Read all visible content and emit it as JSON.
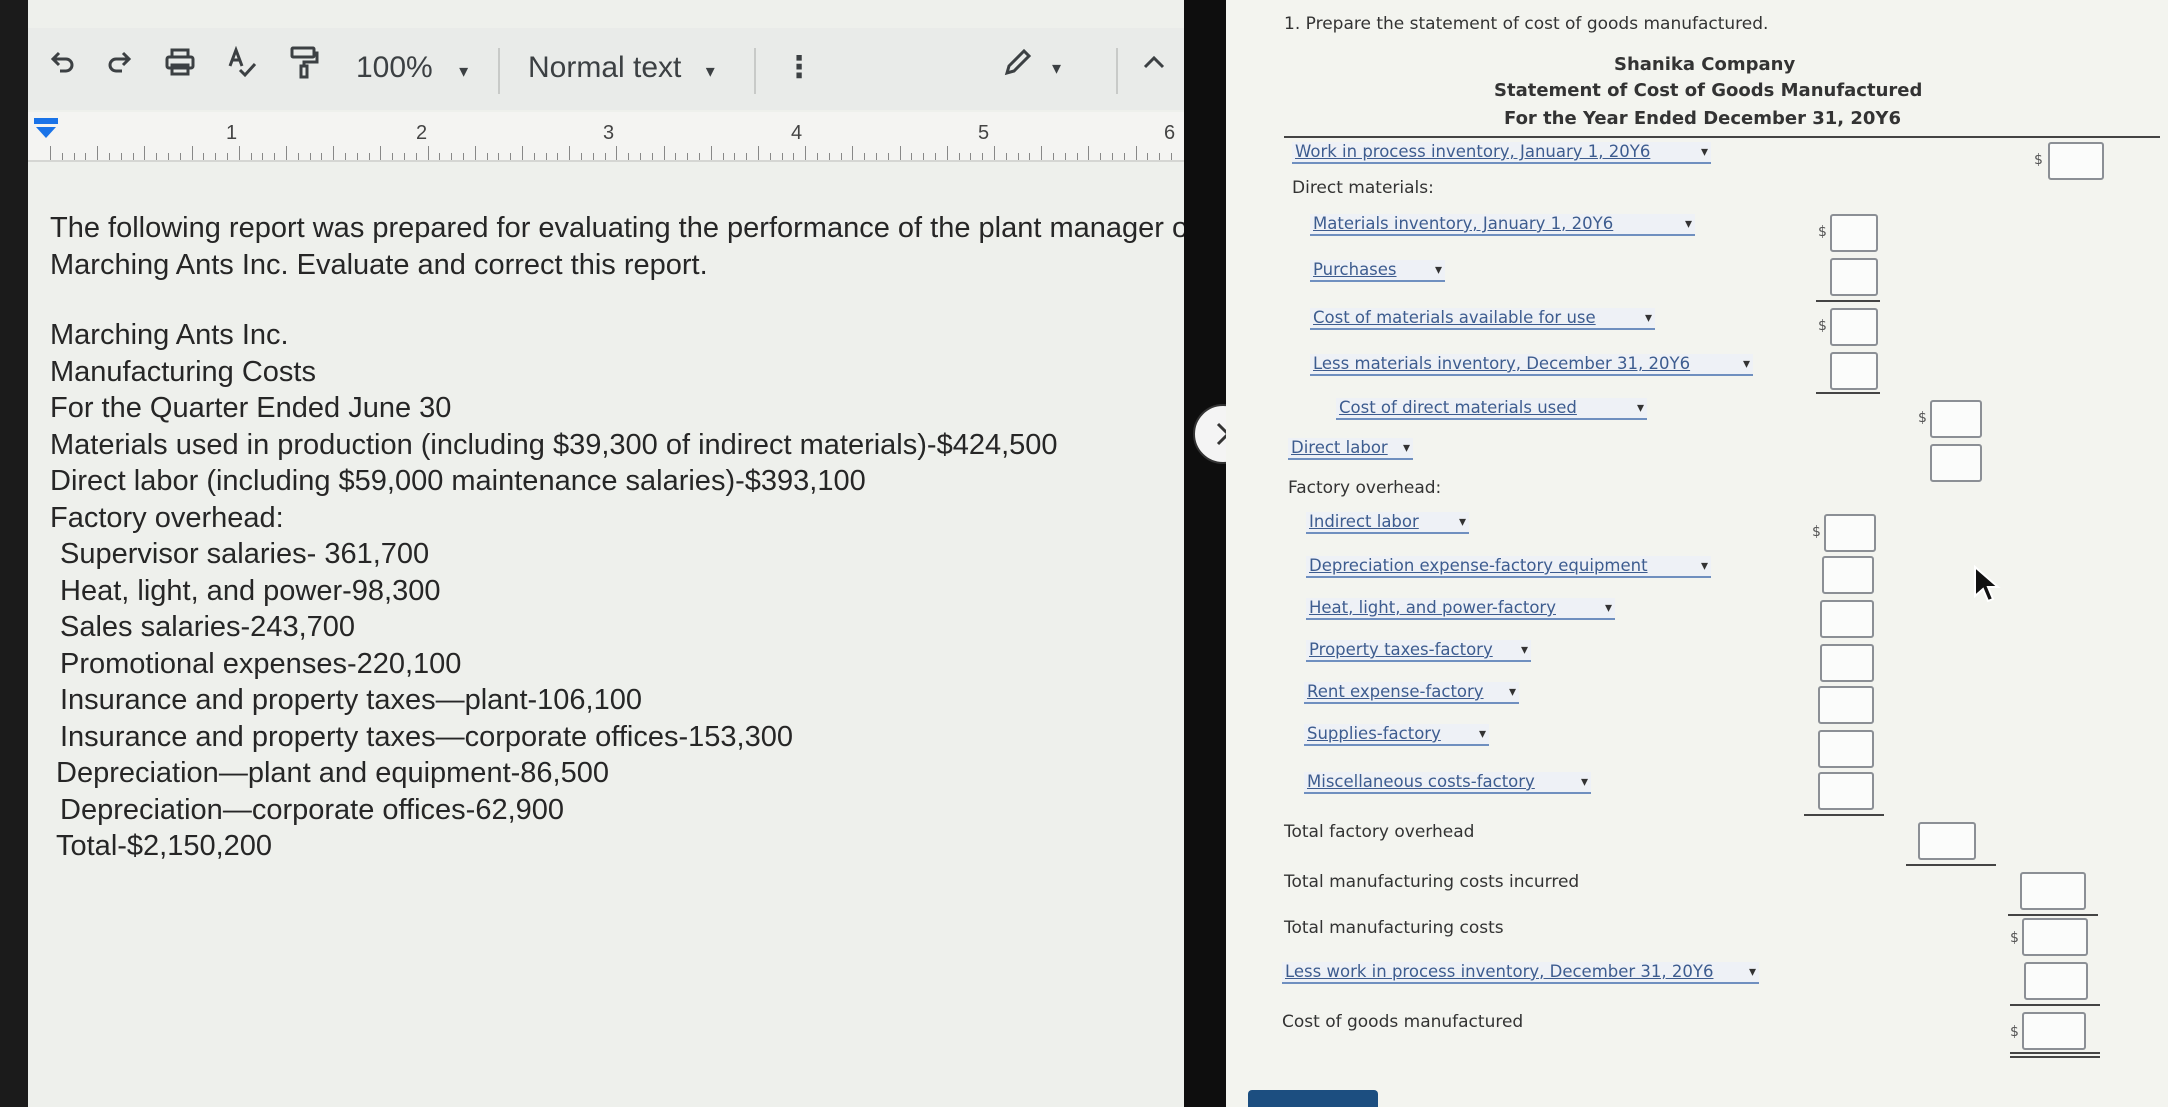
{
  "toolbar": {
    "zoom": "100%",
    "style": "Normal text",
    "more": "⋮"
  },
  "ruler": {
    "marks": [
      "1",
      "2",
      "3",
      "4",
      "5",
      "6"
    ]
  },
  "document": {
    "intro_line1": "The following report was prepared for evaluating the performance of the plant manager of",
    "intro_line2": "Marching Ants Inc. Evaluate and correct this report.",
    "company": "Marching Ants Inc.",
    "report_title": "Manufacturing Costs",
    "period": "For the Quarter Ended June 30",
    "materials": "Materials used in production (including $39,300 of indirect materials)-$424,500",
    "labor": "Direct labor (including $59,000 maintenance salaries)-$393,100",
    "overhead_heading": "Factory overhead:",
    "overhead_items": [
      "Supervisor salaries- 361,700",
      "Heat, light, and power-98,300",
      "Sales salaries-243,700",
      "Promotional expenses-220,100",
      "Insurance and property taxes—plant-106,100",
      "Insurance and property taxes—corporate offices-153,300",
      "Depreciation—plant and equipment-86,500",
      "Depreciation—corporate offices-62,900"
    ],
    "total": "Total-$2,150,200"
  },
  "worksheet": {
    "instruction": "1. Prepare the statement of cost of goods manufactured.",
    "company": "Shanika Company",
    "title": "Statement of Cost of Goods Manufactured",
    "period": "For the Year Ended December 31, 20Y6",
    "dd_wip_begin": "Work in process inventory, January 1, 20Y6",
    "direct_materials_label": "Direct materials:",
    "dd_mat_inv_begin": "Materials inventory, January 1, 20Y6",
    "dd_purchases": "Purchases",
    "dd_cost_avail": "Cost of materials available for use",
    "dd_less_mat_inv": "Less materials inventory, December 31, 20Y6",
    "dd_cost_dm_used": "Cost of direct materials used",
    "dd_direct_labor": "Direct labor",
    "factory_overhead_label": "Factory overhead:",
    "dd_indirect_labor": "Indirect labor",
    "dd_depreciation": "Depreciation expense-factory equipment",
    "dd_heat": "Heat, light, and power-factory",
    "dd_property": "Property taxes-factory",
    "dd_rent": "Rent expense-factory",
    "dd_supplies": "Supplies-factory",
    "dd_misc": "Miscellaneous costs-factory",
    "total_foh": "Total factory overhead",
    "total_mfg_incurred": "Total manufacturing costs incurred",
    "total_mfg": "Total manufacturing costs",
    "dd_less_wip_end": "Less work in process inventory, December 31, 20Y6",
    "cogm": "Cost of goods manufactured",
    "dollar": "$"
  }
}
